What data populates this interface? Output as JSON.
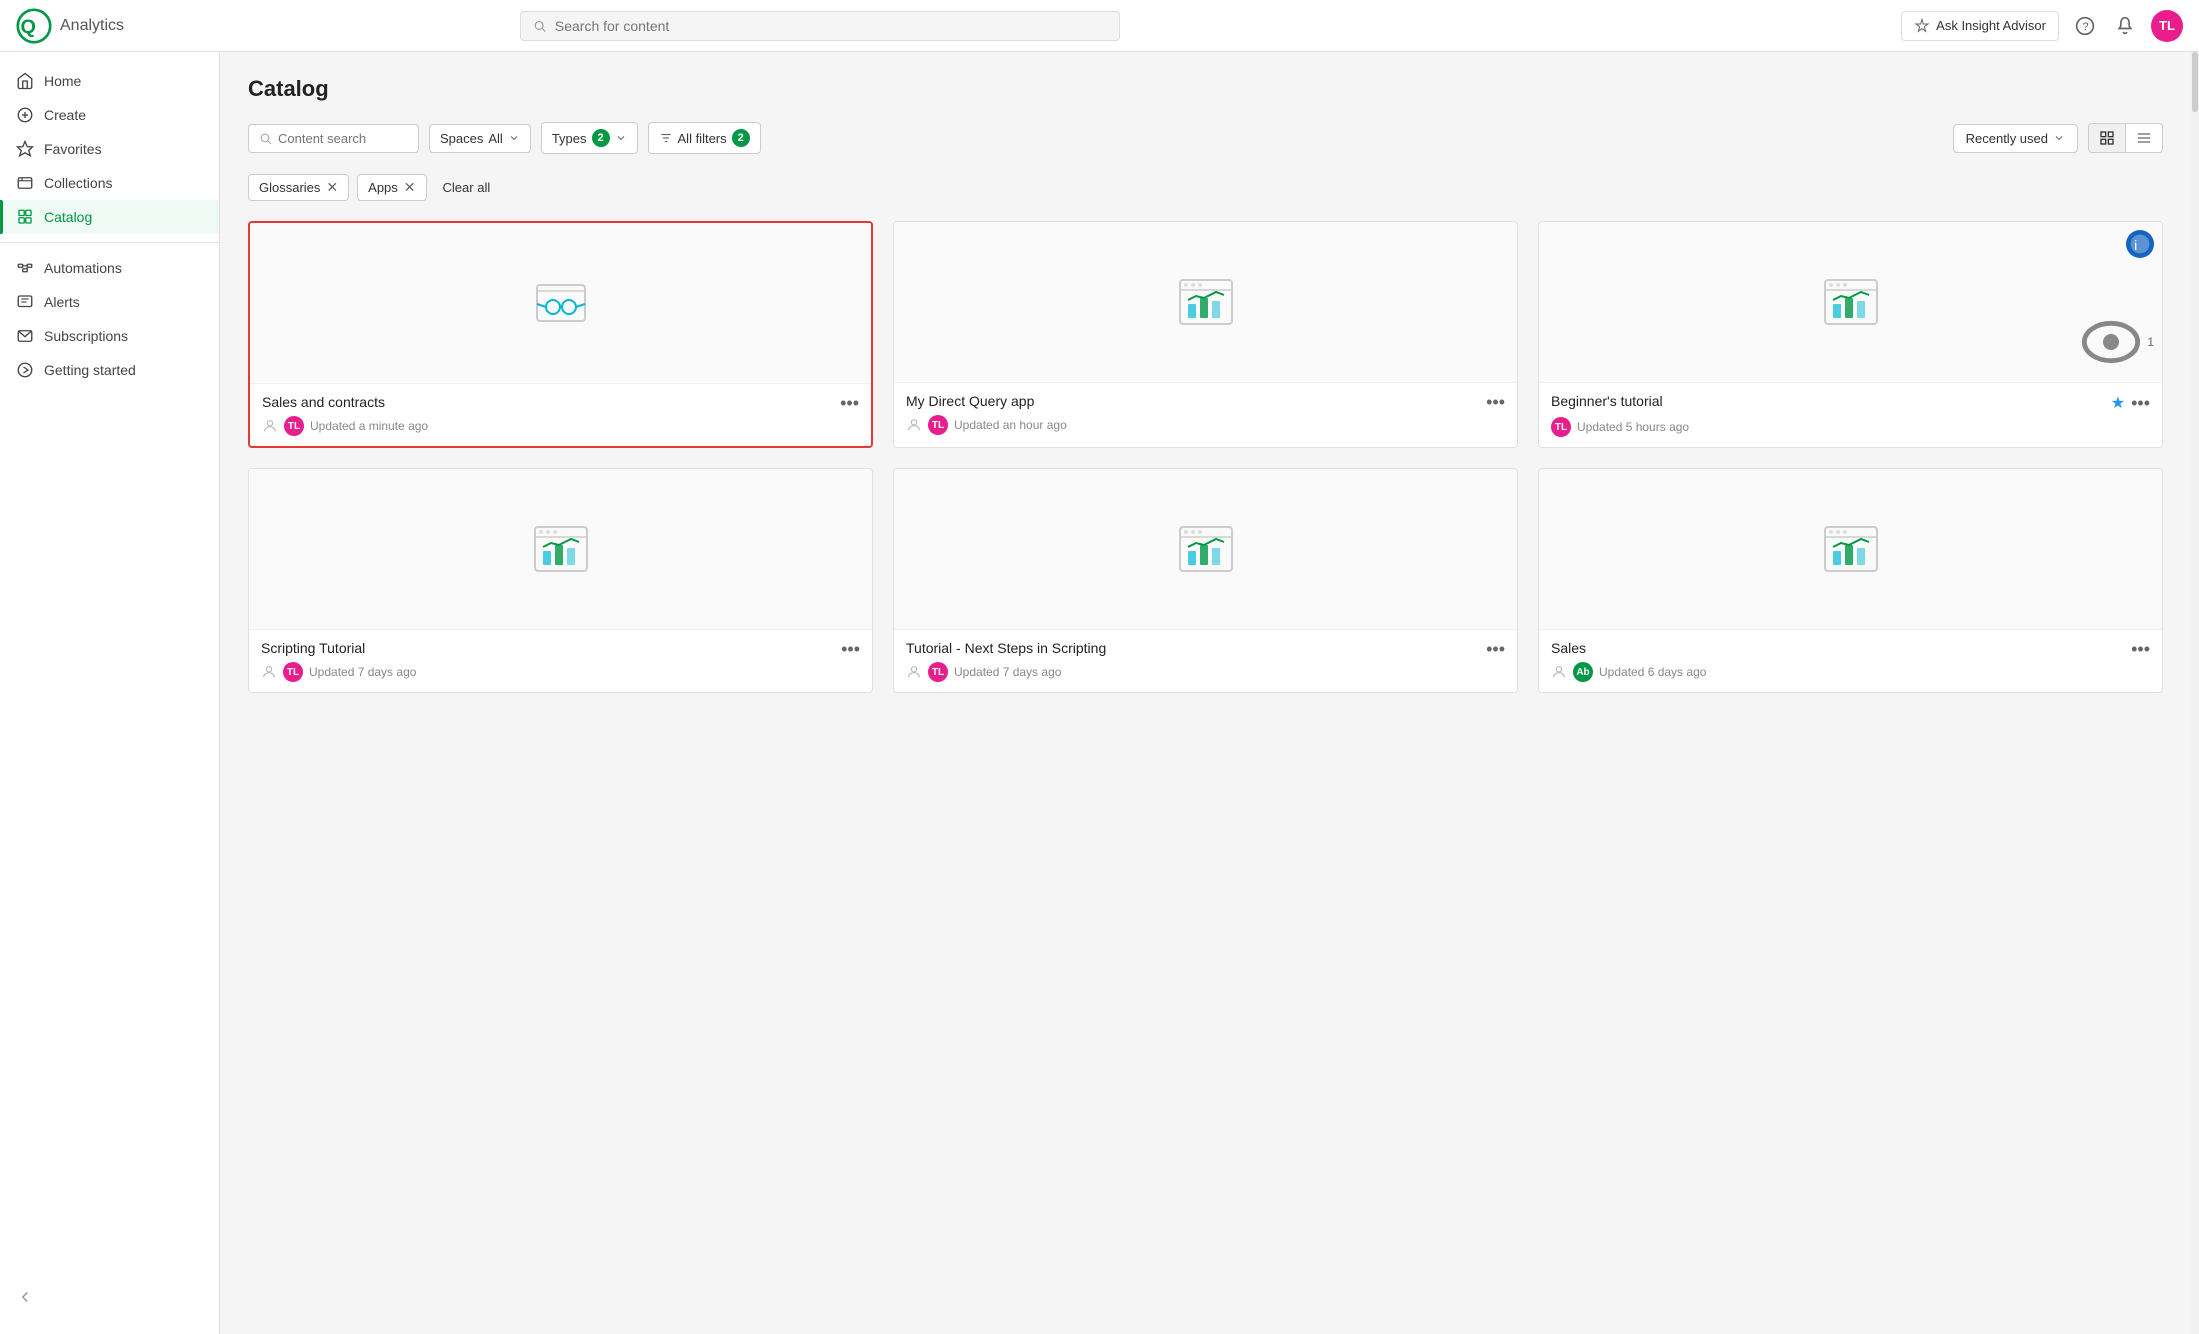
{
  "app": {
    "name": "Analytics",
    "logo_alt": "Qlik logo"
  },
  "topnav": {
    "search_placeholder": "Search for content",
    "insight_advisor_label": "Ask Insight Advisor",
    "avatar_initials": "TL"
  },
  "sidebar": {
    "items": [
      {
        "id": "home",
        "label": "Home",
        "icon": "home-icon"
      },
      {
        "id": "create",
        "label": "Create",
        "icon": "create-icon"
      },
      {
        "id": "favorites",
        "label": "Favorites",
        "icon": "star-icon"
      },
      {
        "id": "collections",
        "label": "Collections",
        "icon": "collections-icon"
      },
      {
        "id": "catalog",
        "label": "Catalog",
        "icon": "catalog-icon",
        "active": true
      },
      {
        "id": "automations",
        "label": "Automations",
        "icon": "automations-icon"
      },
      {
        "id": "alerts",
        "label": "Alerts",
        "icon": "alerts-icon"
      },
      {
        "id": "subscriptions",
        "label": "Subscriptions",
        "icon": "subscriptions-icon"
      },
      {
        "id": "getting-started",
        "label": "Getting started",
        "icon": "getting-started-icon"
      }
    ],
    "collapse_label": "Collapse"
  },
  "catalog": {
    "title": "Catalog",
    "search_placeholder": "Content search",
    "spaces_label": "Spaces",
    "spaces_value": "All",
    "types_label": "Types",
    "types_badge": "2",
    "filters_label": "All filters",
    "filters_badge": "2",
    "sort_label": "Recently used",
    "filter_tags": [
      {
        "id": "glossaries",
        "label": "Glossaries"
      },
      {
        "id": "apps",
        "label": "Apps"
      }
    ],
    "clear_all_label": "Clear all",
    "cards": [
      {
        "id": "sales-contracts",
        "title": "Sales and contracts",
        "updated": "Updated a minute ago",
        "avatar_initials": "TL",
        "avatar_color": "pink",
        "icon_type": "glossary",
        "highlighted": true,
        "views": null,
        "starred": false,
        "owner_icon": true
      },
      {
        "id": "my-direct-query",
        "title": "My Direct Query app",
        "updated": "Updated an hour ago",
        "avatar_initials": "TL",
        "avatar_color": "pink",
        "icon_type": "app",
        "highlighted": false,
        "views": null,
        "starred": false,
        "owner_icon": true
      },
      {
        "id": "beginners-tutorial",
        "title": "Beginner's tutorial",
        "updated": "Updated 5 hours ago",
        "avatar_initials": "TL",
        "avatar_color": "pink",
        "icon_type": "app",
        "highlighted": false,
        "views": 1,
        "starred": true,
        "owner_icon": false,
        "indicator": true
      },
      {
        "id": "scripting-tutorial",
        "title": "Scripting Tutorial",
        "updated": "Updated 7 days ago",
        "avatar_initials": "TL",
        "avatar_color": "pink",
        "icon_type": "app",
        "highlighted": false,
        "views": null,
        "starred": false,
        "owner_icon": true
      },
      {
        "id": "tutorial-next-steps",
        "title": "Tutorial - Next Steps in Scripting",
        "updated": "Updated 7 days ago",
        "avatar_initials": "TL",
        "avatar_color": "pink",
        "icon_type": "app",
        "highlighted": false,
        "views": null,
        "starred": false,
        "owner_icon": true
      },
      {
        "id": "sales",
        "title": "Sales",
        "updated": "Updated 6 days ago",
        "avatar_initials": "Ab",
        "avatar_color": "teal",
        "icon_type": "app",
        "highlighted": false,
        "views": null,
        "starred": false,
        "owner_icon": true
      }
    ]
  },
  "icons": {
    "search": "🔍",
    "chevron_down": "▾",
    "filter": "⊟",
    "grid_view": "⊞",
    "list_view": "≡",
    "more": "•••",
    "star_filled": "★",
    "eye": "👁",
    "arrow_left": "←"
  }
}
